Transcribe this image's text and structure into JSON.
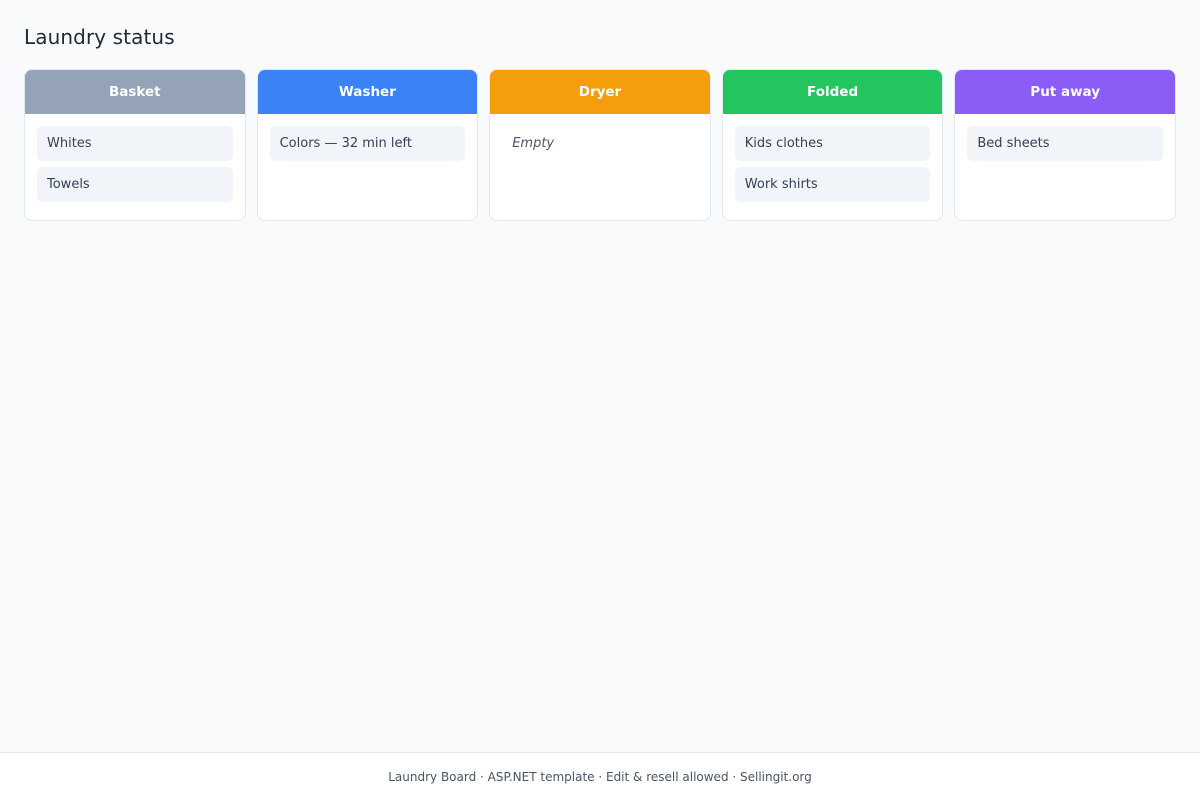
{
  "page": {
    "title": "Laundry status"
  },
  "columns": [
    {
      "title": "Basket",
      "color": "#94a3b8",
      "items": [
        "Whites",
        "Towels"
      ],
      "empty_label": ""
    },
    {
      "title": "Washer",
      "color": "#3b82f6",
      "items": [
        "Colors — 32 min left"
      ],
      "empty_label": ""
    },
    {
      "title": "Dryer",
      "color": "#f59e0b",
      "items": [],
      "empty_label": "Empty"
    },
    {
      "title": "Folded",
      "color": "#22c55e",
      "items": [
        "Kids clothes",
        "Work shirts"
      ],
      "empty_label": ""
    },
    {
      "title": "Put away",
      "color": "#8b5cf6",
      "items": [
        "Bed sheets"
      ],
      "empty_label": ""
    }
  ],
  "footer": {
    "text": "Laundry Board · ASP.NET template · Edit & resell allowed · Sellingit.org"
  }
}
